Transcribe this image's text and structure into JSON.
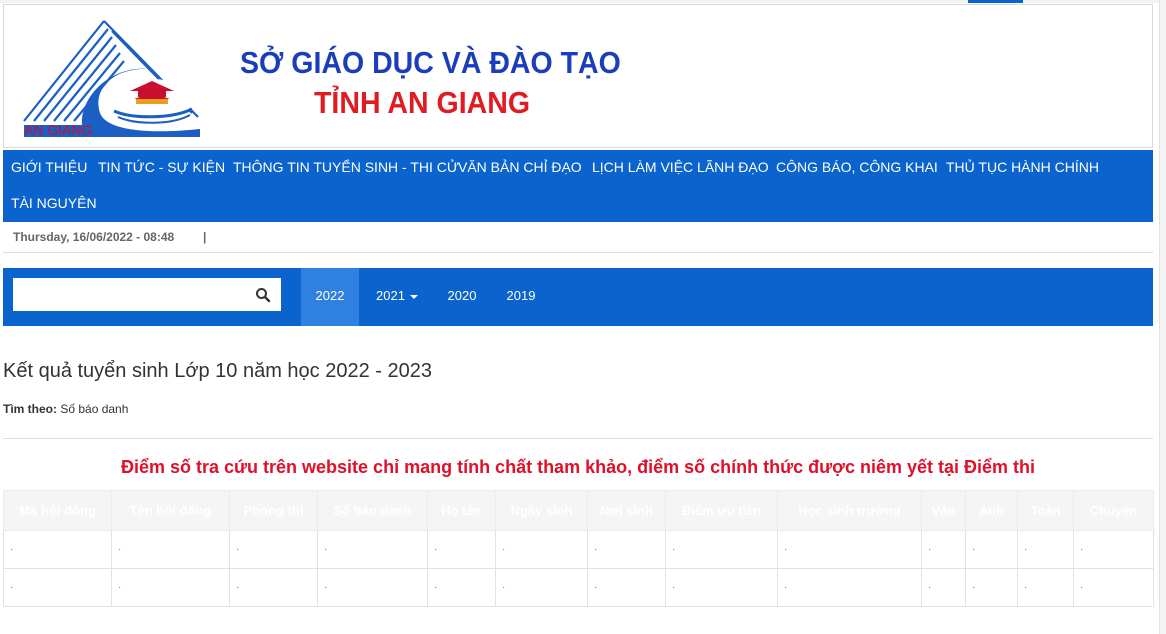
{
  "banner": {
    "logo_text": "AN GIANG",
    "title_line1": "SỞ GIÁO DỤC VÀ ĐÀO TẠO",
    "title_line2": "TỈNH AN GIANG"
  },
  "nav": {
    "items": [
      "GIỚI THIỆU",
      "TIN TỨC - SỰ KIỆN",
      "THÔNG TIN TUYỂN SINH - THI CỬ",
      "VĂN BẢN CHỈ ĐẠO",
      "LỊCH LÀM VIỆC LÃNH ĐẠO",
      "CÔNG BÁO, CÔNG KHAI",
      "THỦ TỤC HÀNH CHÍNH",
      "TÀI NGUYÊN"
    ]
  },
  "datebar": {
    "date": "Thursday, 16/06/2022 - 08:48",
    "separator": "|"
  },
  "search": {
    "value": "",
    "icon": "search-icon"
  },
  "years": {
    "items": [
      "2022",
      "2021",
      "2020",
      "2019"
    ],
    "active": "2022",
    "dropdown": "2021"
  },
  "content": {
    "heading": "Kết quả tuyển sinh Lớp 10 năm học 2022 - 2023",
    "search_by_label": "Tìm theo:",
    "search_by_value": "Số báo danh",
    "notice": "Điểm số tra cứu trên website chỉ mang tính chất tham khảo, điểm số chính thức được niêm yết tại Điểm thi"
  },
  "table": {
    "columns": [
      "Mã hội đồng",
      "Tên hội đồng",
      "Phòng thi",
      "Số báo danh",
      "Họ tên",
      "Ngày sinh",
      "Nơi sinh",
      "Điểm ưu tiên",
      "Học sinh trường",
      "Văn",
      "Anh",
      "Toán",
      "Chuyên"
    ],
    "rows": [
      [
        "·",
        "·",
        "·",
        "·",
        "·",
        "·",
        "·",
        "·",
        "·",
        "·",
        "·",
        "·",
        "·"
      ],
      [
        "·",
        "·",
        "·",
        "·",
        "·",
        "·",
        "·",
        "·",
        "·",
        "·",
        "·",
        "·",
        "·"
      ]
    ]
  },
  "colors": {
    "primary_blue": "#0b63ce",
    "active_tab": "#2f80e0",
    "notice_red": "#e0102a",
    "title_blue": "#1a3dbd",
    "title_red": "#e01b22"
  }
}
